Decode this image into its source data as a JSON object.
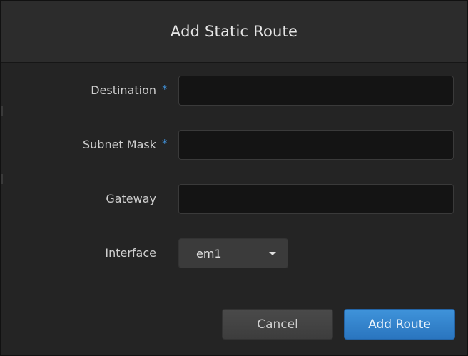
{
  "dialog": {
    "title": "Add Static Route"
  },
  "form": {
    "destination": {
      "label": "Destination",
      "required_mark": "*",
      "value": "",
      "placeholder": ""
    },
    "subnet_mask": {
      "label": "Subnet Mask",
      "required_mark": "*",
      "value": "",
      "placeholder": ""
    },
    "gateway": {
      "label": "Gateway",
      "value": "",
      "placeholder": ""
    },
    "interface": {
      "label": "Interface",
      "selected": "em1"
    }
  },
  "actions": {
    "cancel_label": "Cancel",
    "submit_label": "Add Route"
  },
  "colors": {
    "accent": "#2f80cc",
    "required_mark": "#3f8fd6",
    "background": "#242424",
    "header": "#2c2c2c"
  },
  "icons": {
    "dropdown": "caret-down-icon"
  }
}
